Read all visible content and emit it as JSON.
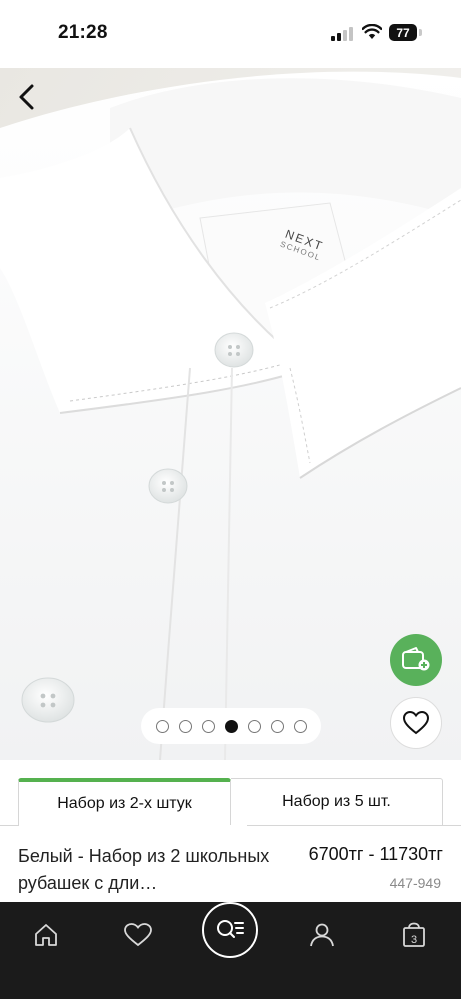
{
  "status_bar": {
    "time": "21:28",
    "battery": "77"
  },
  "gallery": {
    "brand_label": "NEXT",
    "brand_sub": "SCHOOL",
    "total_images": 7,
    "active_image": 4
  },
  "options": {
    "tab_active": "Набор из 2-х штук",
    "tab_other": "Набор из 5 шт."
  },
  "product": {
    "title": "Белый - Набор из 2 школьных рубашек с дли…",
    "price": "6700тг - 11730тг",
    "code": "447-949"
  },
  "nav": {
    "cart_count": "3"
  },
  "colors": {
    "accent_green": "#59b15b",
    "nav_bg": "#1b1b1b"
  },
  "icons": [
    "back-arrow-icon",
    "wallet-add-icon",
    "heart-icon",
    "home-icon",
    "favorites-icon",
    "search-list-icon",
    "profile-icon",
    "cart-icon"
  ]
}
